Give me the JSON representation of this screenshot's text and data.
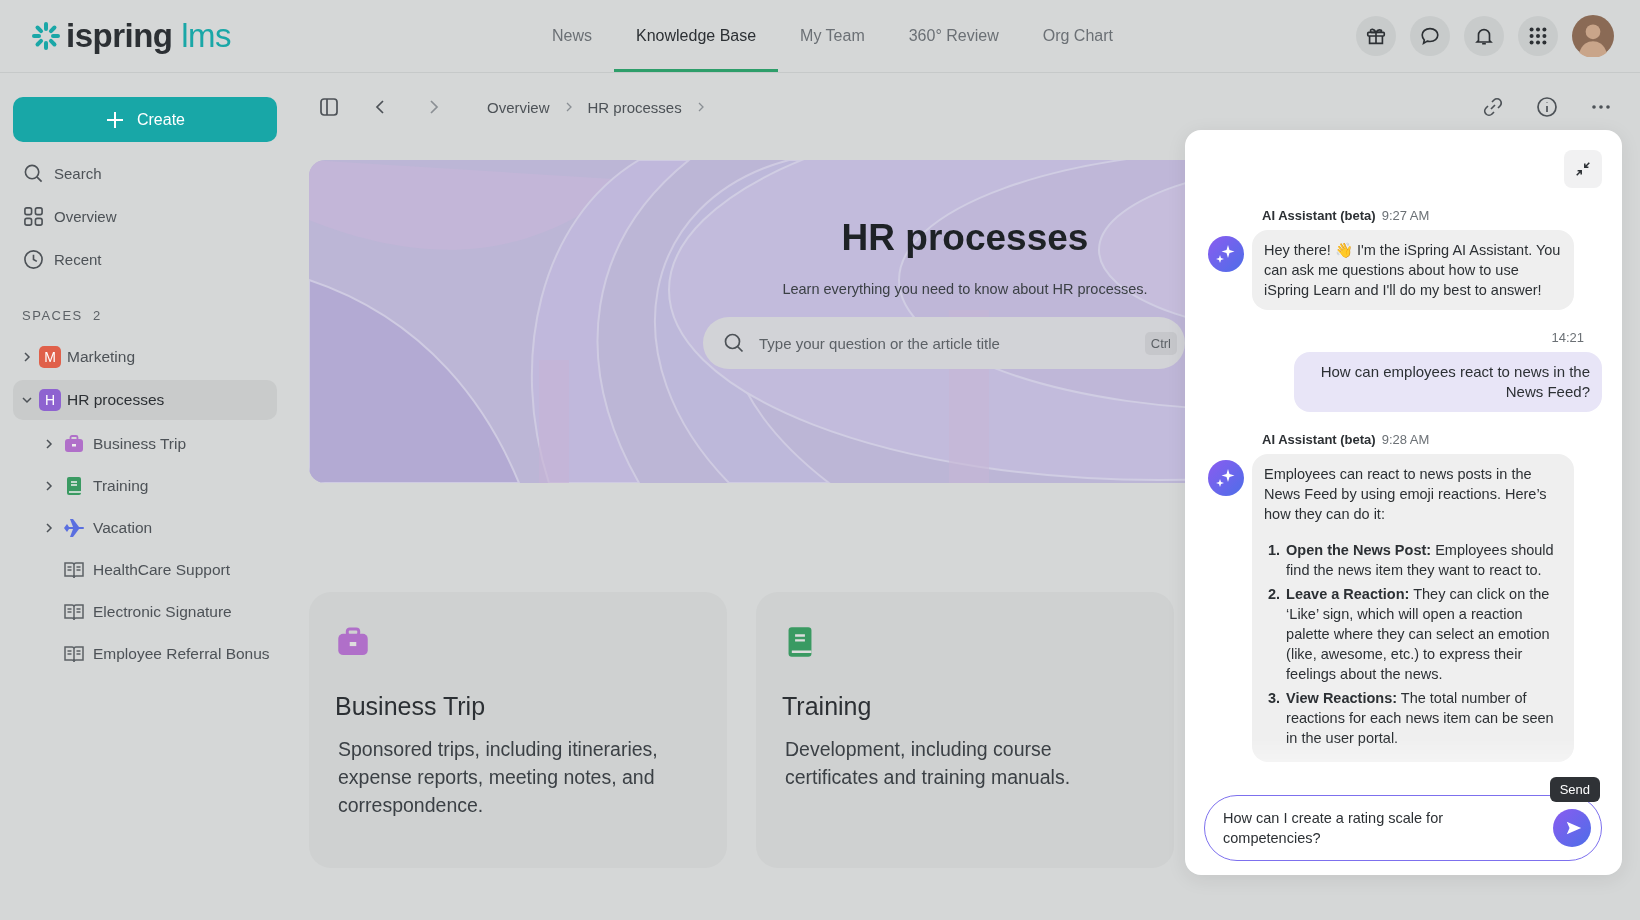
{
  "logo": {
    "name": "ispring",
    "product": "lms"
  },
  "nav": [
    {
      "label": "News",
      "selected": false
    },
    {
      "label": "Knowledge Base",
      "selected": true
    },
    {
      "label": "My Team",
      "selected": false
    },
    {
      "label": "360° Review",
      "selected": false
    },
    {
      "label": "Org Chart",
      "selected": false
    }
  ],
  "sidebar": {
    "create": "Create",
    "items": [
      {
        "label": "Search"
      },
      {
        "label": "Overview"
      },
      {
        "label": "Recent"
      }
    ],
    "spaces_label": "SPACES",
    "spaces_count": "2",
    "spaces": [
      {
        "letter": "M",
        "label": "Marketing",
        "color": "#e0604a",
        "expanded": false,
        "selected": false
      },
      {
        "letter": "H",
        "label": "HR processes",
        "color": "#8e63d0",
        "expanded": true,
        "selected": true,
        "children": [
          {
            "label": "Business Trip",
            "kind": "briefcase",
            "expanded": false
          },
          {
            "label": "Training",
            "kind": "book",
            "expanded": false
          },
          {
            "label": "Vacation",
            "kind": "plane",
            "expanded": false
          },
          {
            "label": "HealthCare Support",
            "kind": "article"
          },
          {
            "label": "Electronic Signature",
            "kind": "article"
          },
          {
            "label": "Employee Referral Bonus",
            "kind": "article"
          }
        ]
      }
    ]
  },
  "breadcrumbs": [
    "Overview",
    "HR processes"
  ],
  "hero": {
    "title": "HR processes",
    "subtitle": "Learn everything you need to know about HR processes.",
    "search": {
      "placeholder": "Type your question or the article title",
      "shortcut": "Ctrl"
    }
  },
  "cards": [
    {
      "kind": "briefcase",
      "title": "Business Trip",
      "description": "Sponsored trips, including itineraries, expense reports, meeting notes, and correspondence."
    },
    {
      "kind": "book",
      "title": "Training",
      "description": "Development, including course certificates and training manuals."
    }
  ],
  "chat": {
    "messages": [
      {
        "kind": "assistant",
        "author": "AI Assistant (beta)",
        "time": "9:27 AM",
        "text": "Hey there! 👋 I'm the iSpring AI Assistant. You can ask me questions about how to use iSpring Learn and I'll do my best to answer!"
      },
      {
        "kind": "user",
        "time": "14:21",
        "text": "How can employees react to news in the News Feed?"
      },
      {
        "kind": "assistant",
        "author": "AI Assistant (beta)",
        "time": "9:28 AM",
        "text": "Employees can react to news posts in the News Feed by using emoji reactions. Here’s how they can do it:",
        "list": [
          {
            "number": "1.",
            "text": "**Open the News Post:** Employees should find the news item they want to react to."
          },
          {
            "number": "2.",
            "text": "**Leave a Reaction:** They can click on the ‘Like’ sign, which will open a reaction palette where they can select an emotion (like, awesome, etc.) to express their feelings about the news."
          },
          {
            "number": "3.",
            "text": "**View Reactions:** The total number of reactions for each news item can be seen in the user portal."
          }
        ]
      }
    ],
    "input": {
      "value": "How can I create a rating scale for competencies?"
    },
    "send_tooltip": "Send"
  }
}
